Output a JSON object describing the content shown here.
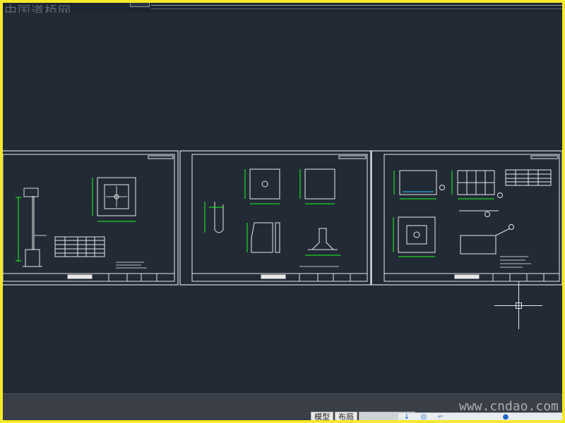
{
  "watermarks": {
    "top": "中国道桥网",
    "bottom": "www.cndao.com"
  },
  "layout_tabs": [
    {
      "label": "模型"
    },
    {
      "label": "布局"
    }
  ],
  "colors": {
    "outer_border": "#f5ea2a",
    "canvas_bg": "#222a36",
    "sheet_line": "#e8e8e8",
    "dimension_green": "#19ff19",
    "accent_cyan": "#2ec9ff",
    "status_bg": "#3a3f47"
  },
  "icons": [
    "crosshair-cursor-icon",
    "snap-icon",
    "grid-icon",
    "ortho-icon",
    "polar-icon"
  ]
}
